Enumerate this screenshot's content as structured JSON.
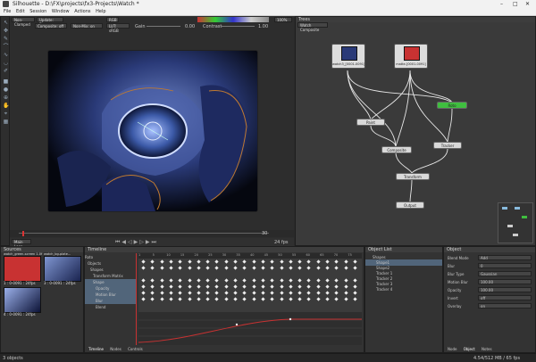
{
  "app": {
    "title": "Silhouette - D:\\FX\\projects\\fx3-Projects\\Watch *",
    "window_controls": [
      "–",
      "□",
      "✕"
    ]
  },
  "menu": [
    "File",
    "Edit",
    "Session",
    "Window",
    "Actions",
    "Help"
  ],
  "viewer_toolbar": {
    "view_select": "Non-Clamped",
    "update_select": "Update: Drag",
    "channel": "RGB",
    "zoom": "100%",
    "composite": "Composite: off",
    "fg_select": "Non-Mix: on",
    "lut": "LUT: sRGB",
    "gain_label": "Gain",
    "gain_value": "0.00",
    "contrast_label": "Contrast",
    "contrast_value": "1.00",
    "bottom_select": "Main Loop",
    "frame_end": "30",
    "fps": "24 fps"
  },
  "trees": {
    "title": "Trees",
    "composite_select": "Watch Composite",
    "nodes": {
      "source1": "watch3_[0001-0091]...",
      "source2": "matte-[0001-0091]",
      "paint": "Paint",
      "roto": "Roto",
      "composite": "Composite",
      "tracker": "Tracker",
      "transform": "Transform",
      "output": "Output"
    }
  },
  "sources": {
    "title": "Sources",
    "items": [
      {
        "label": "watch_green-screen 1.0f",
        "caption": "1 : 0-0091 : 24fps"
      },
      {
        "label": "watch_bg-plate...",
        "caption": "3 : 0-0091 : 24fps"
      },
      {
        "label": "watch3_[0001-0091]...",
        "caption": "4 : 0-0091 : 24fps"
      }
    ]
  },
  "timeline": {
    "title": "Timeline",
    "rows": [
      "Roto",
      "Objects",
      "Shapes",
      "Transform Matrix",
      "Shape",
      "Opacity",
      "Motion Blur",
      "Blur",
      "Blend"
    ],
    "ticks": [
      "1",
      "5",
      "10",
      "15",
      "20",
      "25",
      "30",
      "35",
      "40",
      "45",
      "50",
      "55",
      "60",
      "65",
      "70",
      "75"
    ],
    "tabs": [
      "Timeline",
      "Nodes",
      "Controls"
    ]
  },
  "object_list": {
    "title": "Object List",
    "items": [
      "Shapes",
      "Shape1",
      "Shape2",
      "Tracker 1",
      "Tracker 2",
      "Tracker 3",
      "Tracker 4"
    ]
  },
  "object_panel": {
    "title": "Object",
    "fields": [
      {
        "label": "Blend Mode",
        "value": "Add"
      },
      {
        "label": "Blur",
        "value": "0"
      },
      {
        "label": "Blur Type",
        "value": "Gaussian"
      },
      {
        "label": "Motion Blur",
        "value": "100.00"
      },
      {
        "label": "Opacity",
        "value": "100.00"
      },
      {
        "label": "Invert",
        "value": "off"
      },
      {
        "label": "Overlay",
        "value": "on"
      }
    ],
    "tabs": [
      "Node",
      "Object",
      "Notes"
    ]
  },
  "status": {
    "left": "3 objects",
    "right": "4.54/512 MB / 65 fps"
  },
  "colors": {
    "bg": "#2b2b2b",
    "panel": "#333333",
    "accent_red": "#c83232",
    "node_green": "#3fbe3f",
    "wire": "#e8e8e8"
  }
}
